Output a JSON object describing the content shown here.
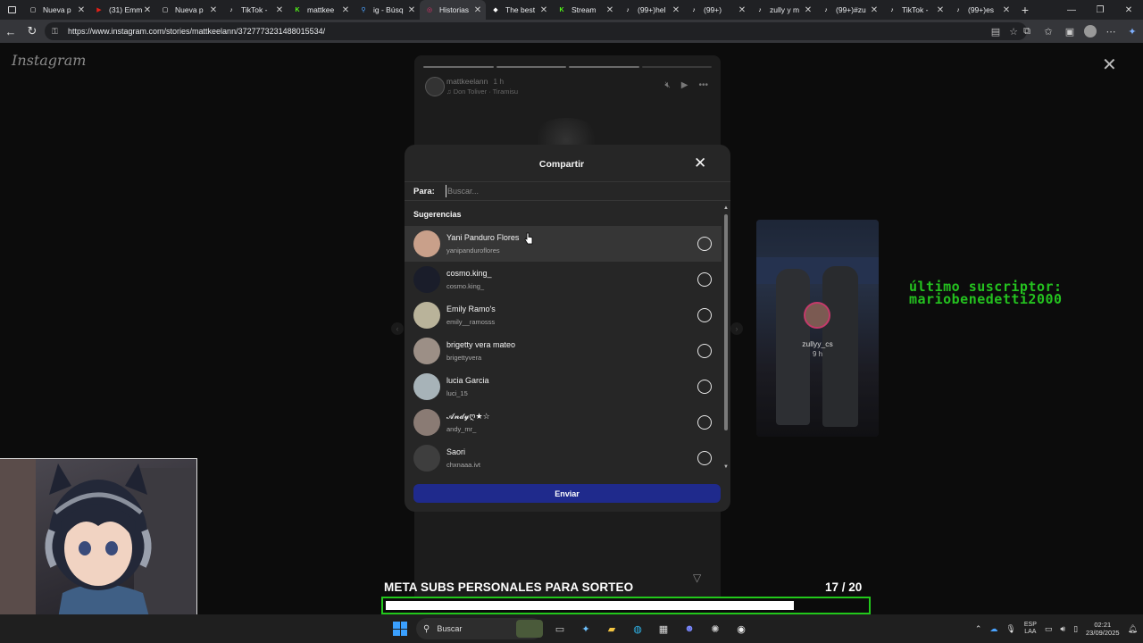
{
  "browser": {
    "tabs": [
      {
        "title": "Nueva p",
        "fav_color": "#ffffff",
        "fav_glyph": "▢"
      },
      {
        "title": "(31) Emm",
        "fav_color": "#e62117",
        "fav_glyph": "▶"
      },
      {
        "title": "Nueva p",
        "fav_color": "#ffffff",
        "fav_glyph": "▢"
      },
      {
        "title": "TikTok -",
        "fav_color": "#ffffff",
        "fav_glyph": "♪"
      },
      {
        "title": "mattkee",
        "fav_color": "#53fc18",
        "fav_glyph": "K"
      },
      {
        "title": "ig - Búsq",
        "fav_color": "#4da3ff",
        "fav_glyph": "⚲"
      },
      {
        "title": "Historias",
        "fav_color": "#e1306c",
        "fav_glyph": "◎",
        "active": true
      },
      {
        "title": "The best",
        "fav_color": "#ffffff",
        "fav_glyph": "◆"
      },
      {
        "title": "Stream",
        "fav_color": "#53fc18",
        "fav_glyph": "K"
      },
      {
        "title": "(99+)hel",
        "fav_color": "#ffffff",
        "fav_glyph": "♪"
      },
      {
        "title": "(99+)",
        "fav_color": "#ffffff",
        "fav_glyph": "♪"
      },
      {
        "title": "zully y m",
        "fav_color": "#ffffff",
        "fav_glyph": "♪"
      },
      {
        "title": "(99+)#zu",
        "fav_color": "#ffffff",
        "fav_glyph": "♪"
      },
      {
        "title": "TikTok -",
        "fav_color": "#ffffff",
        "fav_glyph": "♪"
      },
      {
        "title": "(99+)es",
        "fav_color": "#ffffff",
        "fav_glyph": "♪"
      }
    ],
    "url": "https://www.instagram.com/stories/mattkeelann/3727773231488015534/"
  },
  "instagram": {
    "logo": "Instagram",
    "story": {
      "username": "mattkeelann",
      "time": "1 h",
      "song": "Don Toliver · Tiramisu"
    },
    "side_story": {
      "username": "zullyy_cs",
      "time": "9 h"
    }
  },
  "share_modal": {
    "title": "Compartir",
    "to_label": "Para:",
    "search_placeholder": "Buscar...",
    "suggestions_label": "Sugerencias",
    "send_label": "Enviar",
    "suggestions": [
      {
        "name": "Yani Panduro Flores",
        "handle": "yanipanduroflores",
        "avatar_color": "#c9a08a"
      },
      {
        "name": "cosmo.king_",
        "handle": "cosmo.king_",
        "avatar_color": "#1a1d2a"
      },
      {
        "name": "Emily Ramo's",
        "handle": "emily__ramosss",
        "avatar_color": "#b9b39a"
      },
      {
        "name": "brigetty vera mateo",
        "handle": "brigettyvera",
        "avatar_color": "#9c8f86"
      },
      {
        "name": "lucia Garcia",
        "handle": "luci_15",
        "avatar_color": "#a7b3b8"
      },
      {
        "name": "𝓐𝓷𝓭𝔂ღ★☆",
        "handle": "andy_mr_",
        "avatar_color": "#8a7b74"
      },
      {
        "name": "Saori",
        "handle": "chxnaaa.ivt",
        "avatar_color": "#3e3e3e"
      }
    ]
  },
  "stream_overlay": {
    "last_sub_line1": "último suscriptor:",
    "last_sub_line2": "mariobenedetti2000",
    "goal_title": "META SUBS PERSONALES PARA SORTEO",
    "goal_count": "17  / 20",
    "goal_current": 17,
    "goal_target": 20
  },
  "taskbar": {
    "search_label": "Buscar",
    "lang_line1": "ESP",
    "lang_line2": "LAA",
    "time": "02:21",
    "date": "23/09/2025"
  }
}
